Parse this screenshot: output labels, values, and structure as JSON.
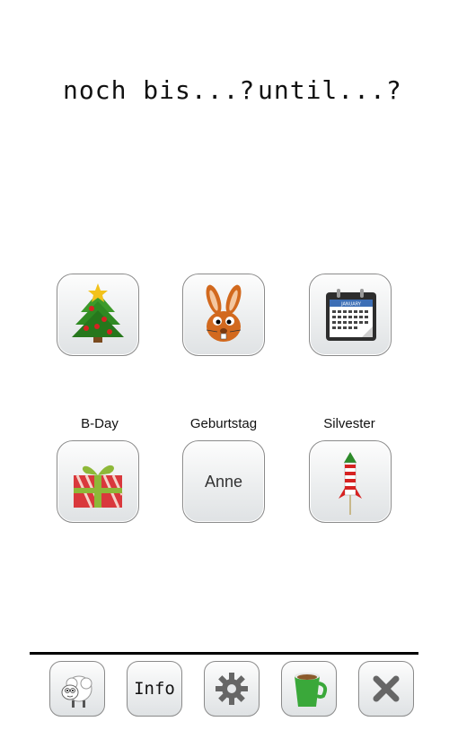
{
  "header": {
    "left_text": "noch bis...?",
    "right_text": "until...?"
  },
  "tiles": [
    {
      "caption": "",
      "icon": "christmas-tree-icon"
    },
    {
      "caption": "",
      "icon": "easter-bunny-icon"
    },
    {
      "caption": "",
      "icon": "calendar-icon",
      "calendar_month": "JANUARY"
    },
    {
      "caption": "B-Day",
      "icon": "gift-icon"
    },
    {
      "caption": "Geburtstag",
      "label": "Anne"
    },
    {
      "caption": "Silvester",
      "icon": "firework-rocket-icon"
    }
  ],
  "toolbar": {
    "info_label": "Info",
    "icons": [
      "sheep-icon",
      "info-button",
      "gear-icon",
      "coffee-cup-icon",
      "close-icon"
    ]
  }
}
